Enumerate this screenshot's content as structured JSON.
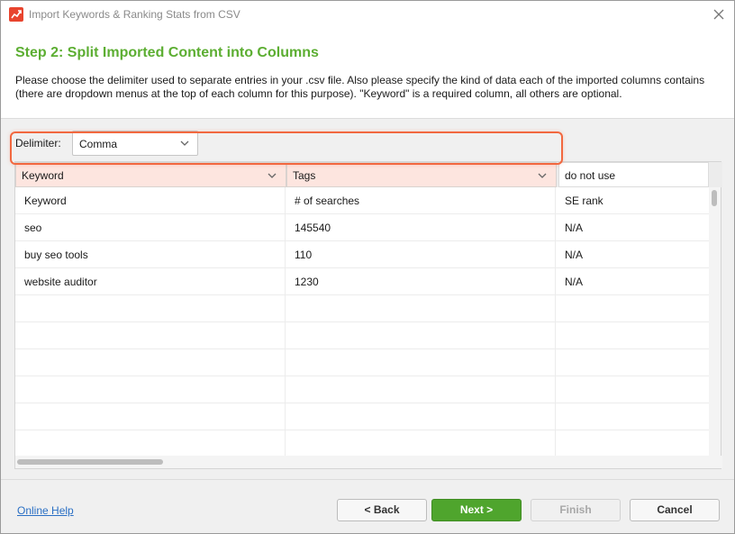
{
  "window": {
    "title": "Import Keywords & Ranking Stats from CSV"
  },
  "step": {
    "title": "Step 2: Split Imported Content into Columns",
    "description": "Please choose the delimiter used to separate entries in your .csv file. Also please specify the kind of data each of the imported columns contains (there are dropdown menus at the top of each column for this purpose). \"Keyword\" is a required column, all others are optional."
  },
  "delimiter": {
    "label": "Delimiter:",
    "value": "Comma"
  },
  "columns": [
    {
      "type": "Keyword"
    },
    {
      "type": "Tags"
    },
    {
      "type": "do not use"
    }
  ],
  "rows": [
    [
      "Keyword",
      "# of searches",
      "SE rank"
    ],
    [
      "seo",
      "145540",
      "N/A"
    ],
    [
      "buy seo tools",
      "110",
      "N/A"
    ],
    [
      "website auditor",
      "1230",
      "N/A"
    ]
  ],
  "footer": {
    "help_link": "Online Help",
    "back_label": "< Back",
    "next_label": "Next >",
    "finish_label": "Finish",
    "cancel_label": "Cancel"
  },
  "colors": {
    "accent_green": "#5cae32",
    "highlight_orange": "#f2683f",
    "next_button": "#4fa52d",
    "link_blue": "#2a6fc4"
  },
  "icons": [
    "app-logo-icon",
    "close-icon",
    "chevron-down-icon"
  ]
}
